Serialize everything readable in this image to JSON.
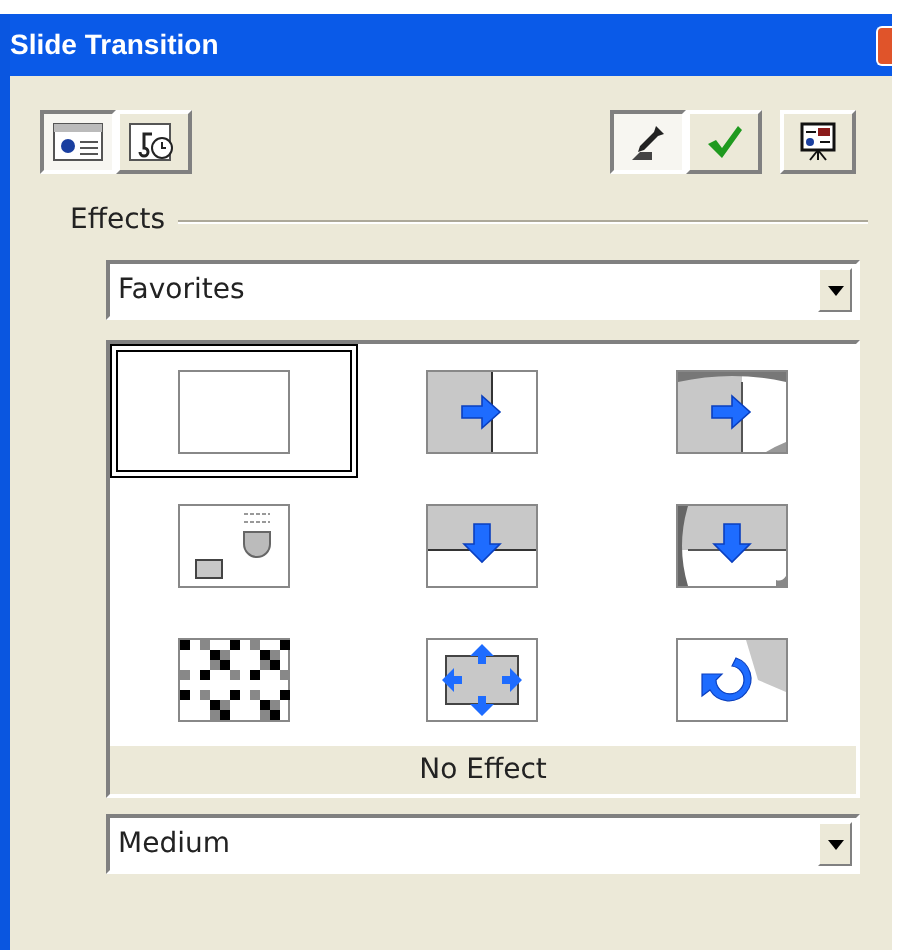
{
  "window": {
    "title": "Slide Transition"
  },
  "mode_tabs": [
    {
      "kind": "effects",
      "selected": true
    },
    {
      "kind": "sound",
      "selected": false
    }
  ],
  "tools": [
    {
      "kind": "eyedropper",
      "selected": true
    },
    {
      "kind": "apply",
      "selected": false
    },
    {
      "kind": "preview",
      "selected": false
    }
  ],
  "effects": {
    "label": "Effects",
    "category": "Favorites",
    "caption": "No Effect",
    "speed": "Medium",
    "tiles": [
      {
        "kind": "none",
        "selected": true
      },
      {
        "kind": "push-right",
        "selected": false
      },
      {
        "kind": "cover-right",
        "selected": false
      },
      {
        "kind": "fly-in",
        "selected": false
      },
      {
        "kind": "push-down",
        "selected": false
      },
      {
        "kind": "cover-down",
        "selected": false
      },
      {
        "kind": "dissolve",
        "selected": false
      },
      {
        "kind": "expand",
        "selected": false
      },
      {
        "kind": "rotate",
        "selected": false
      }
    ]
  }
}
